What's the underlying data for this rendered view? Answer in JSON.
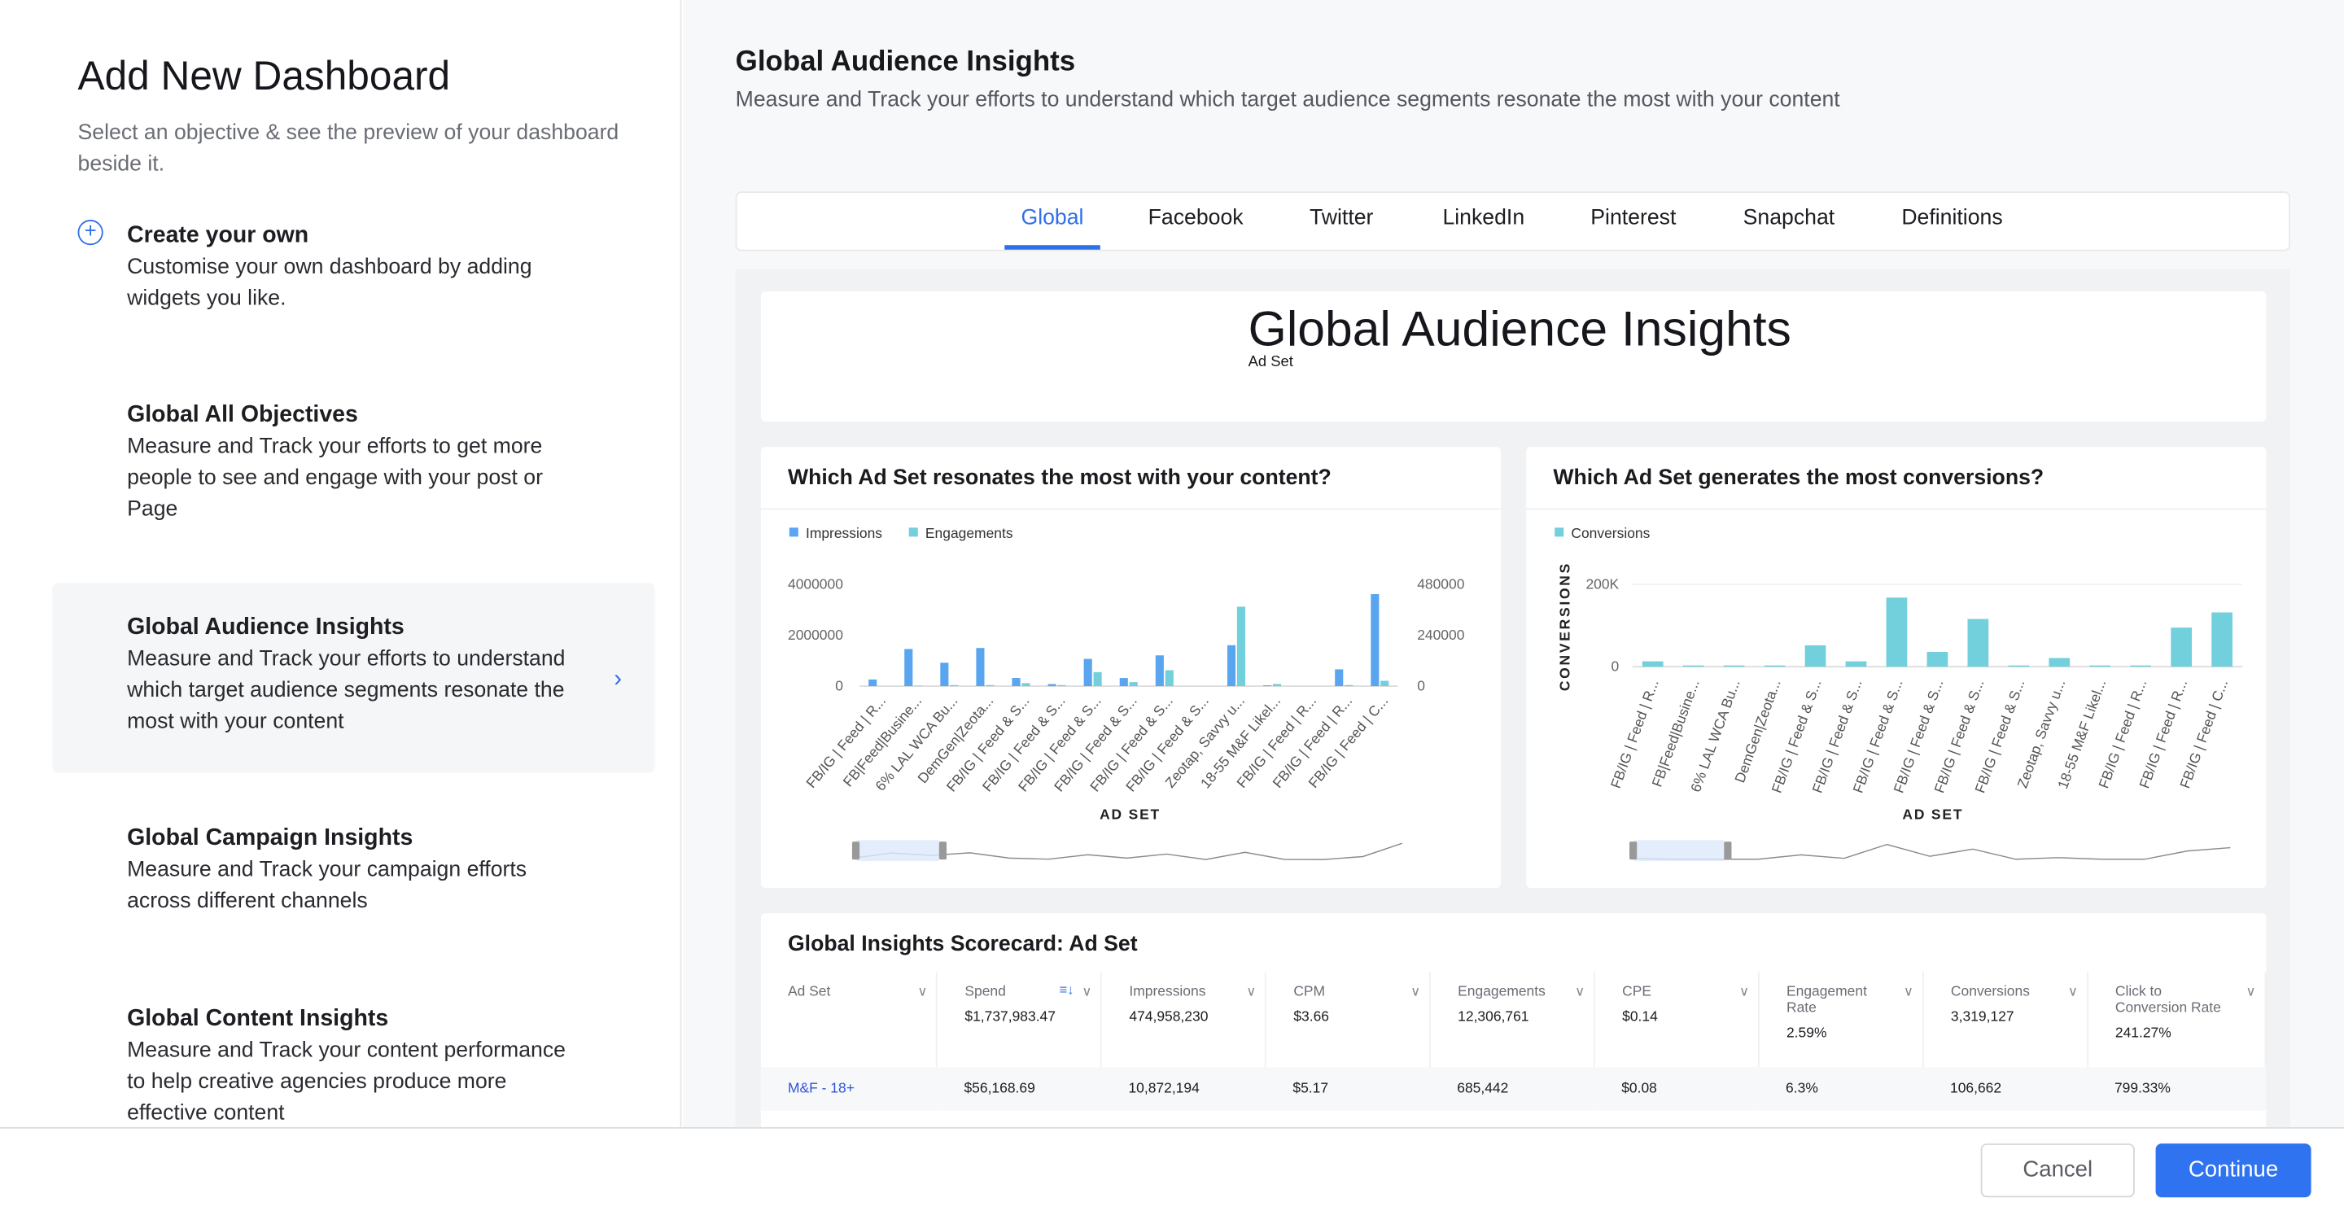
{
  "left": {
    "title": "Add New Dashboard",
    "subtitle": "Select an objective & see the preview of your dashboard beside it.",
    "objectives": [
      {
        "title": "Create your own",
        "desc": "Customise your own dashboard by adding widgets you like.",
        "icon": "plus-circle-icon"
      },
      {
        "title": "Global All Objectives",
        "desc": "Measure and Track your efforts to get more people to see and engage with your post or Page"
      },
      {
        "title": "Global Audience Insights",
        "desc": "Measure and Track your efforts to understand which target audience segments resonate the most with your content",
        "selected": true
      },
      {
        "title": "Global Campaign Insights",
        "desc": "Measure and Track your campaign efforts across different channels"
      },
      {
        "title": "Global Content Insights",
        "desc": "Measure and Track your content performance to help creative agencies produce more effective content"
      }
    ]
  },
  "right": {
    "title": "Global Audience Insights",
    "subtitle": "Measure and Track your efforts to understand which target audience segments resonate the most with your content",
    "tabs": [
      "Global",
      "Facebook",
      "Twitter",
      "LinkedIn",
      "Pinterest",
      "Snapchat",
      "Definitions"
    ],
    "active_tab": "Global",
    "preview_title": "Global Audience Insights",
    "preview_subtitle": "Ad Set"
  },
  "colors": {
    "accent": "#2f73f0",
    "impressions": "#5aa5ef",
    "engagements": "#72cfdc",
    "conversions": "#72cfdc"
  },
  "chart_data": [
    {
      "type": "bar",
      "title": "Which Ad Set resonates the most with your content?",
      "xlabel": "AD SET",
      "ylabel": "",
      "legend": "top-left",
      "categories": [
        "FB/IG | Feed | R...",
        "FB|Feed|Busine...",
        "6% LAL WCA Bu...",
        "DemGen|Zeota...",
        "FB/IG | Feed & S...",
        "FB/IG | Feed & S...",
        "FB/IG | Feed & S...",
        "FB/IG | Feed & S...",
        "FB/IG | Feed & S...",
        "FB/IG | Feed & S...",
        "Zeotap, Savvy u...",
        "18-55 M&F Likel...",
        "FB/IG | Feed | R...",
        "FB/IG | Feed | R...",
        "FB/IG | Feed | C..."
      ],
      "series": [
        {
          "name": "Impressions",
          "axis": "left",
          "values": [
            260000,
            1460000,
            920000,
            1500000,
            320000,
            80000,
            1070000,
            320000,
            1210000,
            0,
            1610000,
            30000,
            0,
            660000,
            3620000
          ]
        },
        {
          "name": "Engagements",
          "axis": "right",
          "values": [
            0,
            2000,
            5000,
            5000,
            14000,
            5000,
            66000,
            19000,
            75000,
            0,
            375000,
            10000,
            0,
            5000,
            25000
          ]
        }
      ],
      "ylim_left": [
        0,
        4000000
      ],
      "ylim_right": [
        0,
        480000
      ],
      "yticks_left": [
        "4000000",
        "2000000",
        "0"
      ],
      "yticks_right": [
        "480000",
        "240000",
        "0"
      ],
      "grid": false
    },
    {
      "type": "bar",
      "title": "Which Ad Set generates the most conversions?",
      "xlabel": "AD SET",
      "ylabel": "CONVERSIONS",
      "legend": "top-left",
      "categories": [
        "FB/IG | Feed | R...",
        "FB|Feed|Busine...",
        "6% LAL WCA Bu...",
        "DemGen|Zeota...",
        "FB/IG | Feed & S...",
        "FB/IG | Feed & S...",
        "FB/IG | Feed & S...",
        "FB/IG | Feed & S...",
        "FB/IG | Feed & S...",
        "FB/IG | Feed & S...",
        "Zeotap, Savvy u...",
        "18-55 M&F Likel...",
        "FB/IG | Feed | R...",
        "FB/IG | Feed | R...",
        "FB/IG | Feed | C..."
      ],
      "series": [
        {
          "name": "Conversions",
          "values": [
            13000,
            3000,
            3000,
            3000,
            52000,
            13000,
            168000,
            36000,
            116000,
            3000,
            21000,
            3000,
            3000,
            95000,
            132000
          ]
        }
      ],
      "ylim": [
        0,
        200000
      ],
      "yticks": [
        "200K",
        "0"
      ],
      "grid": true
    }
  ],
  "scorecard": {
    "title": "Global Insights Scorecard: Ad Set",
    "columns": [
      {
        "label": "Ad Set",
        "total": ""
      },
      {
        "label": "Spend",
        "total": "$1,737,983.47",
        "sorted": true
      },
      {
        "label": "Impressions",
        "total": "474,958,230"
      },
      {
        "label": "CPM",
        "total": "$3.66"
      },
      {
        "label": "Engagements",
        "total": "12,306,761"
      },
      {
        "label": "CPE",
        "total": "$0.14"
      },
      {
        "label": "Engagement Rate",
        "total": "2.59%"
      },
      {
        "label": "Conversions",
        "total": "3,319,127"
      },
      {
        "label": "Click to Conversion Rate",
        "total": "241.27%"
      }
    ],
    "rows": [
      [
        "M&F - 18+",
        "$56,168.69",
        "10,872,194",
        "$5.17",
        "685,442",
        "$0.08",
        "6.3%",
        "106,662",
        "799.33%"
      ]
    ]
  },
  "footer": {
    "cancel": "Cancel",
    "continue": "Continue"
  }
}
